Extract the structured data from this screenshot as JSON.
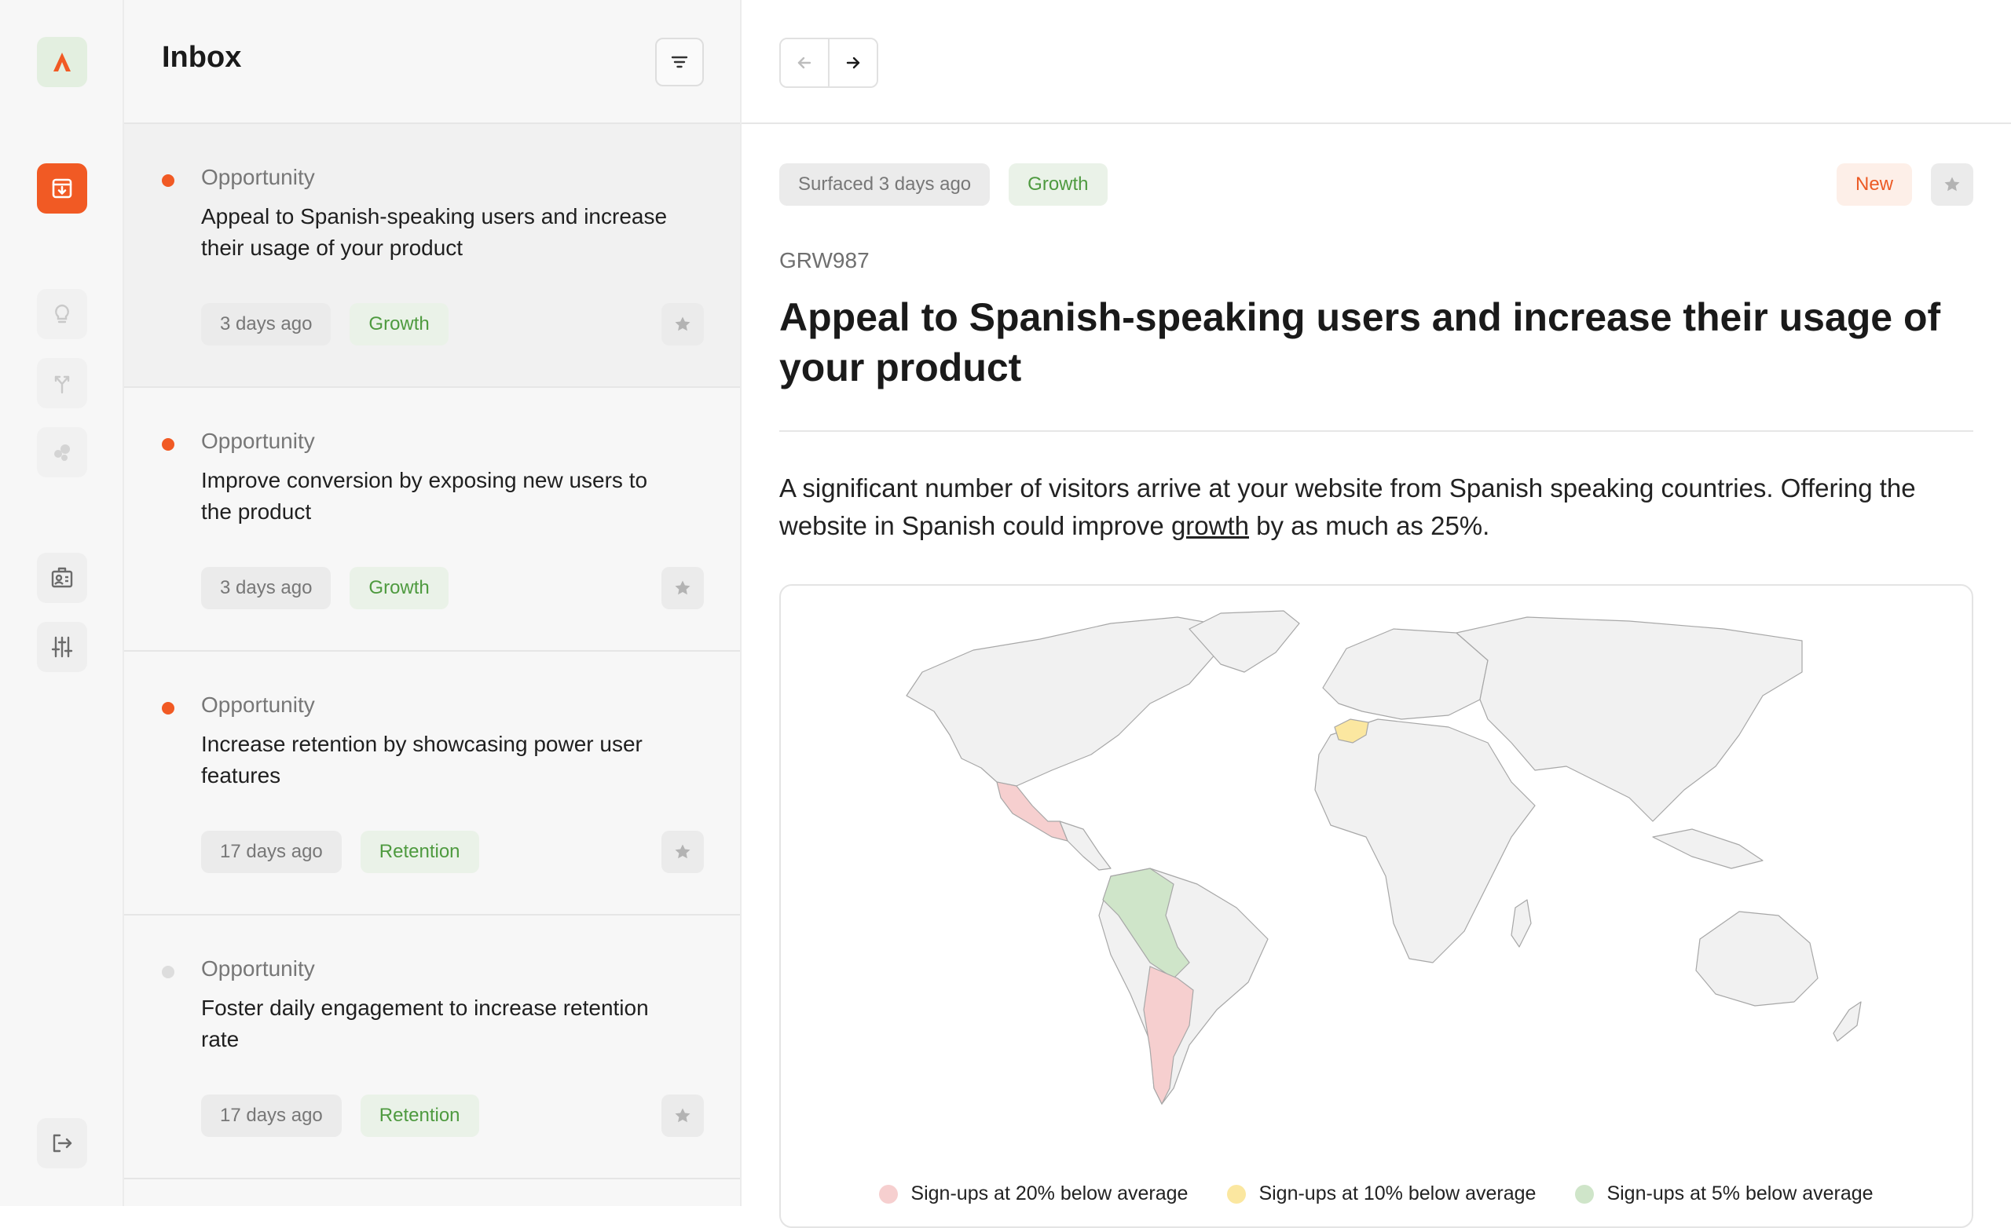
{
  "colors": {
    "accent": "#f15a24",
    "unread_dot": "#f15a24",
    "read_dot": "#dddddd",
    "tag_green": "#4e9a3f",
    "legend_red": "#f6cfcf",
    "legend_yellow": "#fbe7a0",
    "legend_green": "#cfe5c9"
  },
  "rail": {
    "items": [
      {
        "name": "logo",
        "icon": "logo-a-icon"
      },
      {
        "name": "inbox",
        "icon": "inbox-download-icon",
        "active": true
      },
      {
        "name": "ideas",
        "icon": "lightbulb-icon"
      },
      {
        "name": "merge",
        "icon": "merge-arrows-icon"
      },
      {
        "name": "segments",
        "icon": "bubbles-icon"
      },
      {
        "name": "profile",
        "icon": "id-card-icon"
      },
      {
        "name": "settings",
        "icon": "sliders-icon"
      },
      {
        "name": "logout",
        "icon": "logout-icon"
      }
    ]
  },
  "inbox": {
    "title": "Inbox",
    "filter_icon": "filter-icon",
    "items": [
      {
        "type": "Opportunity",
        "title": "Appeal to Spanish-speaking users and increase their usage of your product",
        "time": "3 days ago",
        "tag": "Growth",
        "unread": true,
        "selected": true
      },
      {
        "type": "Opportunity",
        "title": "Improve conversion by exposing new users to the product",
        "time": "3 days ago",
        "tag": "Growth",
        "unread": true,
        "selected": false
      },
      {
        "type": "Opportunity",
        "title": "Increase retention by showcasing power user features",
        "time": "17 days ago",
        "tag": "Retention",
        "unread": true,
        "selected": false
      },
      {
        "type": "Opportunity",
        "title": "Foster daily engagement to increase retention rate",
        "time": "17 days ago",
        "tag": "Retention",
        "unread": false,
        "selected": false
      }
    ]
  },
  "detail": {
    "surfaced": "Surfaced 3 days ago",
    "tag": "Growth",
    "status": "New",
    "code": "GRW987",
    "title": "Appeal to Spanish-speaking users and increase their usage of your product",
    "body_before": "A significant number of visitors arrive at your website from Spanish speaking countries. Offering the website in Spanish could improve ",
    "body_link": "growth",
    "body_after": " by as much as 25%.",
    "legend": [
      {
        "label": "Sign-ups at 20% below average",
        "color": "#f6cfcf"
      },
      {
        "label": "Sign-ups at 10% below average",
        "color": "#fbe7a0"
      },
      {
        "label": "Sign-ups at 5% below average",
        "color": "#cfe5c9"
      }
    ]
  }
}
